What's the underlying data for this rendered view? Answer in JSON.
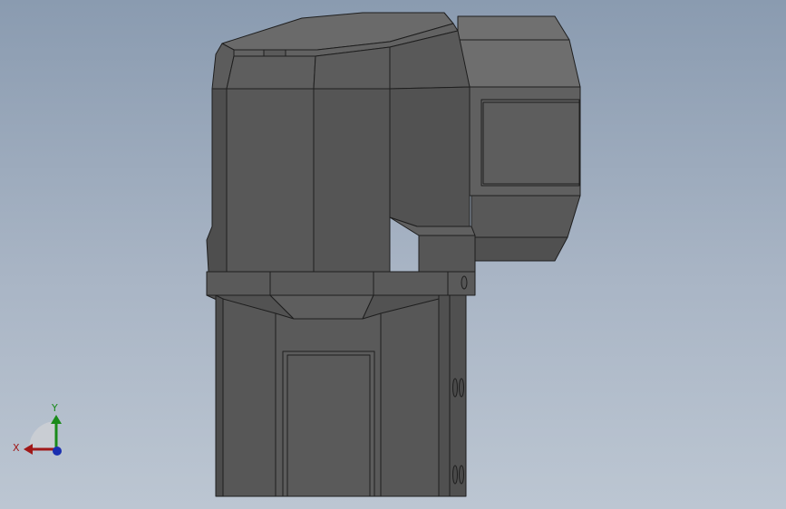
{
  "viewport": {
    "background_top": "#8a9bb0",
    "background_bottom": "#bcc6d2"
  },
  "model": {
    "body_color": "#575757",
    "dark_color": "#4a4a4a",
    "light_color": "#6e6e6e",
    "edge_color": "#1e1e1e"
  },
  "triad": {
    "x_label": "X",
    "y_label": "Y",
    "x_color": "#a01818",
    "y_color": "#1a8a1a",
    "z_color": "#1a2fb0"
  }
}
